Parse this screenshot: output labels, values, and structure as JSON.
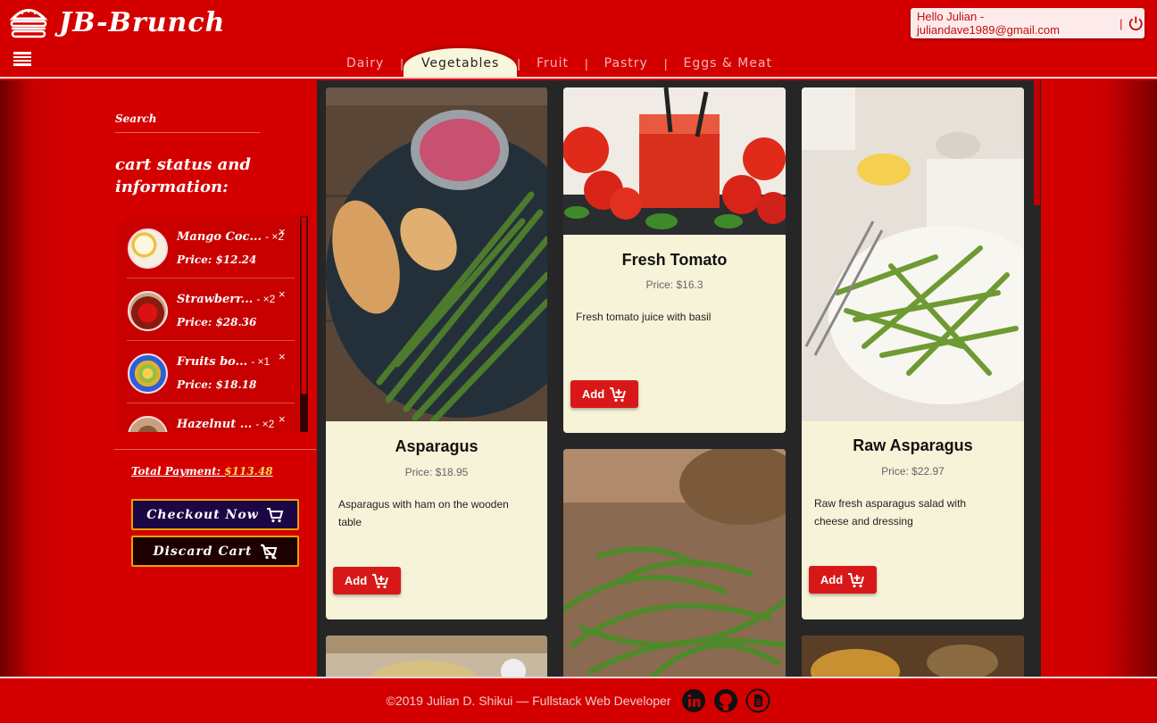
{
  "header": {
    "brand": "JB-Brunch",
    "greeting": "Hello Julian - juliandave1989@gmail.com",
    "greeting_sep": "|"
  },
  "tabs": [
    {
      "label": "Dairy"
    },
    {
      "label": "Vegetables"
    },
    {
      "label": "Fruit"
    },
    {
      "label": "Pastry"
    },
    {
      "label": "Eggs & Meat"
    }
  ],
  "tab_separator": "|",
  "sidebar": {
    "search_label": "Search",
    "cart_heading": "cart status and information:",
    "cart_items": [
      {
        "name": "Mango Coc...",
        "qty": "- ×2",
        "price": "Price: $12.24",
        "remove": "×"
      },
      {
        "name": "Strawberr...",
        "qty": "- ×2",
        "price": "Price: $28.36",
        "remove": "×"
      },
      {
        "name": "Fruits bo...",
        "qty": "- ×1",
        "price": "Price: $18.18",
        "remove": "×"
      },
      {
        "name": "Hazelnut ...",
        "qty": "- ×2",
        "price": "",
        "remove": "×"
      }
    ],
    "total_label": "Total Payment:",
    "total_amount": "$113.48",
    "checkout_label": "Checkout Now",
    "discard_label": "Discard Cart"
  },
  "products": [
    {
      "title": "Asparagus",
      "price": "Price: $18.95",
      "desc": "Asparagus with ham on the wooden table",
      "add_label": "Add"
    },
    {
      "title": "Fresh Tomato",
      "price": "Price: $16.3",
      "desc": "Fresh tomato juice with basil",
      "add_label": "Add"
    },
    {
      "title": "Raw Asparagus",
      "price": "Price: $22.97",
      "desc": "Raw fresh asparagus salad with cheese and dressing",
      "add_label": "Add"
    }
  ],
  "footer": {
    "text": "©2019 Julian D. Shikui — Fullstack Web Developer"
  },
  "colors": {
    "primary_red": "#d40000",
    "card_bg": "#f7f3d8",
    "grid_bg": "#262626",
    "total_amount": "#ffd84a",
    "checkout_bg": "#1d0644"
  }
}
